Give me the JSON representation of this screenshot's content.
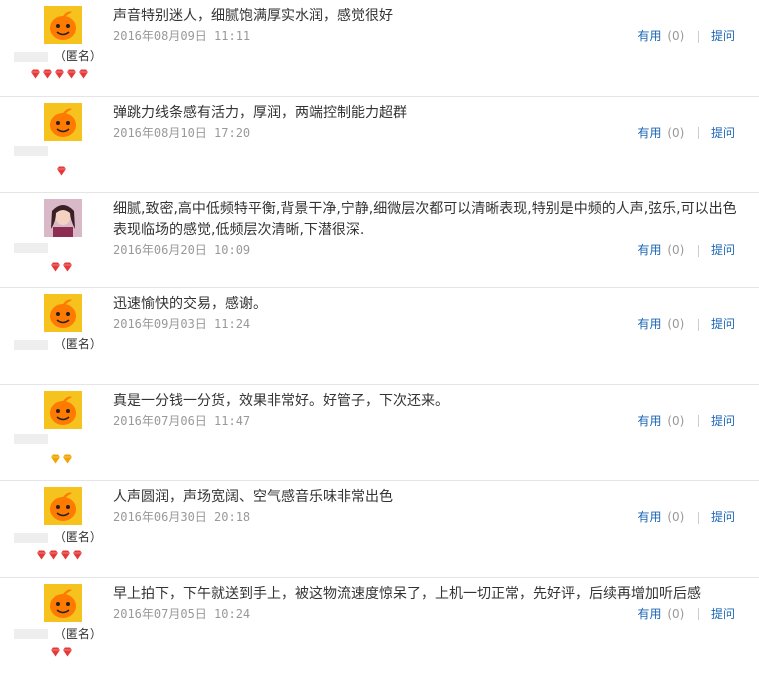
{
  "labels": {
    "useful": "有用",
    "ask": "提问"
  },
  "colors": {
    "link": "#1a66b3",
    "muted": "#999999",
    "red_badge": "#e63a3a",
    "gold_badge": "#f0a400"
  },
  "reviews": [
    {
      "content": "声音特别迷人，细腻饱满厚实水润，感觉很好",
      "date": "2016年08月09日 11:11",
      "count": "(0)",
      "user_suffix": "（匿名）",
      "badge": "red",
      "badge_count": 5,
      "avatar": "mascot"
    },
    {
      "content": "弹跳力线条感有活力，厚润，两端控制能力超群",
      "date": "2016年08月10日 17:20",
      "count": "(0)",
      "user_suffix": "",
      "badge": "red",
      "badge_count": 1,
      "avatar": "mascot"
    },
    {
      "content": "细腻,致密,高中低频特平衡,背景干净,宁静,细微层次都可以清晰表现,特别是中频的人声,弦乐,可以出色表现临场的感觉,低频层次清晰,下潜很深.",
      "date": "2016年06月20日 10:09",
      "count": "(0)",
      "user_suffix": "",
      "badge": "red",
      "badge_count": 2,
      "avatar": "photo"
    },
    {
      "content": "迅速愉快的交易，感谢。",
      "date": "2016年09月03日 11:24",
      "count": "(0)",
      "user_suffix": "（匿名）",
      "badge": "none",
      "badge_count": 0,
      "avatar": "mascot"
    },
    {
      "content": "真是一分钱一分货，效果非常好。好管子，下次还来。",
      "date": "2016年07月06日 11:47",
      "count": "(0)",
      "user_suffix": "",
      "badge": "gold",
      "badge_count": 2,
      "avatar": "mascot"
    },
    {
      "content": "人声圆润，声场宽阔、空气感音乐味非常出色",
      "date": "2016年06月30日 20:18",
      "count": "(0)",
      "user_suffix": "（匿名）",
      "badge": "red",
      "badge_count": 4,
      "avatar": "mascot"
    },
    {
      "content": "早上拍下，下午就送到手上，被这物流速度惊呆了，上机一切正常，先好评，后续再增加听后感",
      "date": "2016年07月05日 10:24",
      "count": "(0)",
      "user_suffix": "（匿名）",
      "badge": "red",
      "badge_count": 2,
      "avatar": "mascot"
    }
  ]
}
